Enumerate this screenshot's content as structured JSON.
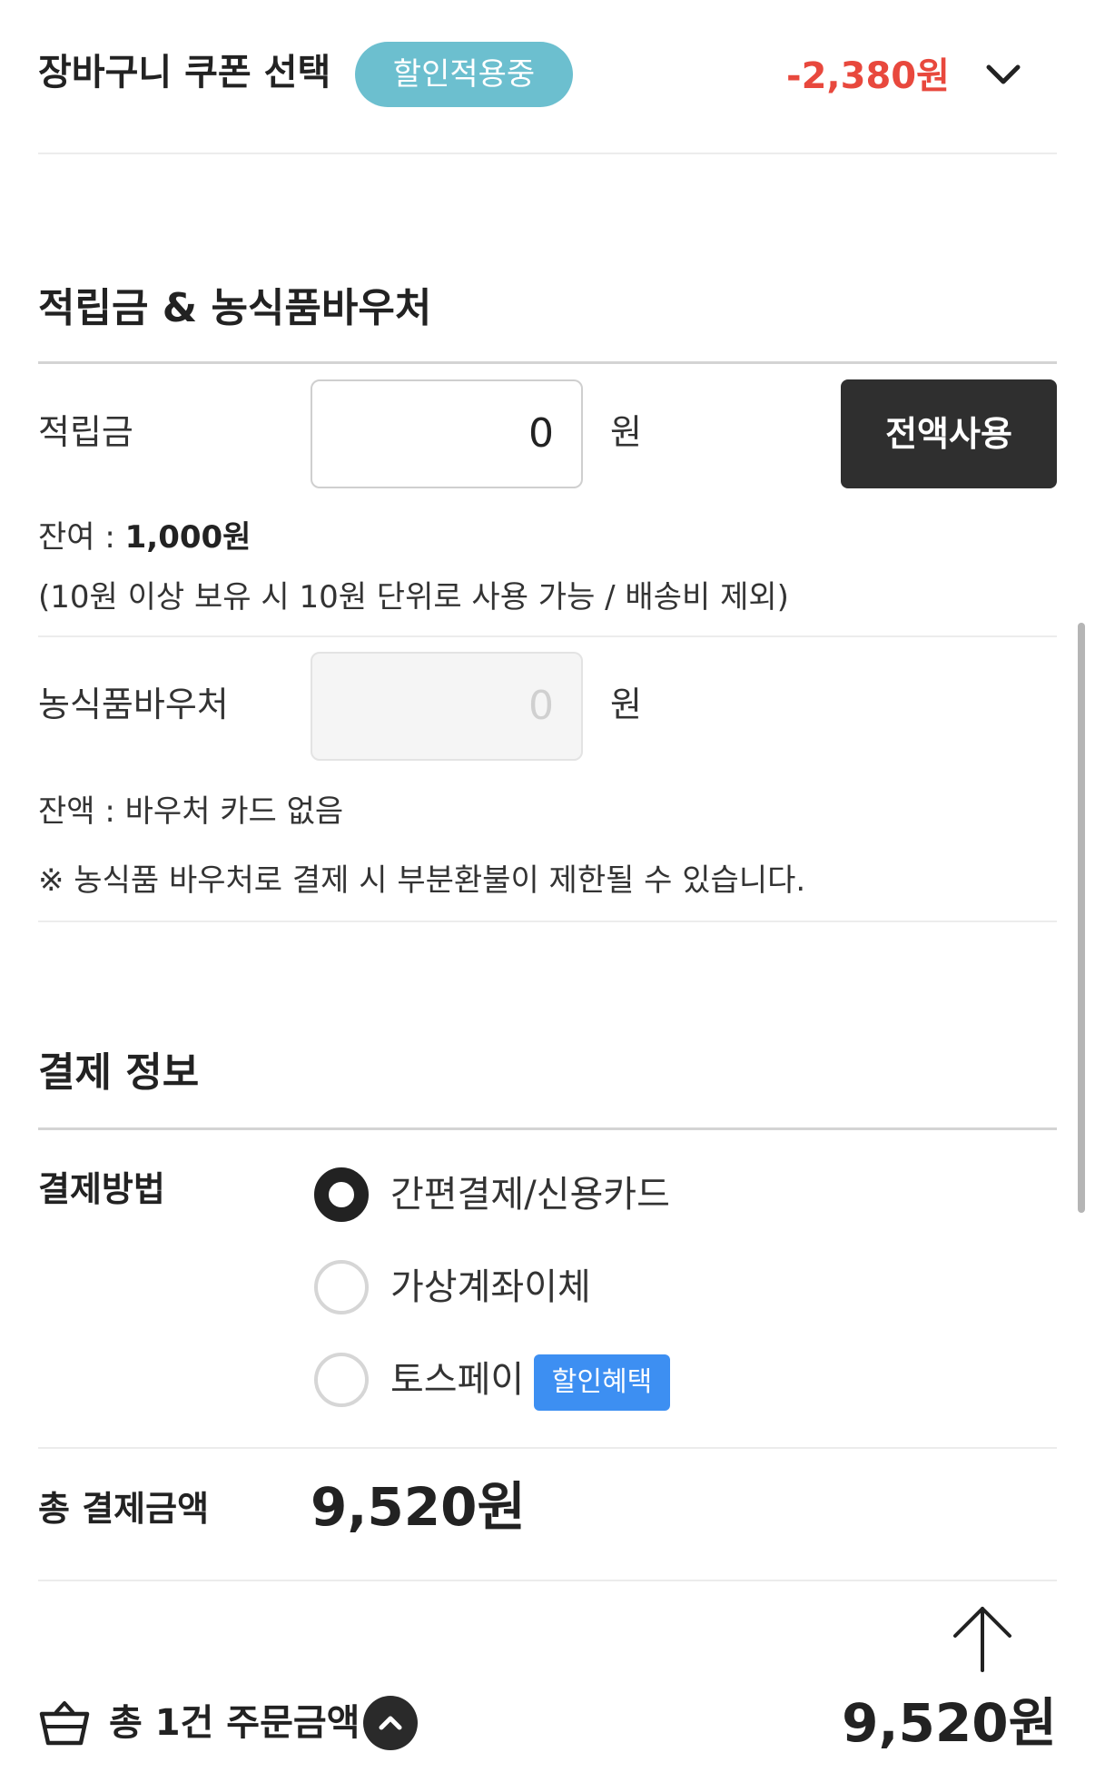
{
  "coupon": {
    "title": "장바구니 쿠폰 선택",
    "badge": "할인적용중",
    "amount": "-2,380원",
    "amount_color": "#e8483d",
    "badge_color": "#6cbfcf",
    "toggle_icon": "chevron-down-icon"
  },
  "points_section": {
    "title": "적립금 & 농식품바우처",
    "points": {
      "label": "적립금",
      "value": "0",
      "unit": "원",
      "use_all_button": "전액사용",
      "balance_prefix": "잔여 : ",
      "balance_value": "1,000원",
      "note": "(10원 이상 보유 시 10원 단위로 사용 가능 / 배송비 제외)"
    },
    "voucher": {
      "label": "농식품바우처",
      "placeholder": "0",
      "unit": "원",
      "balance": "잔액 : 바우처 카드 없음",
      "notice": "※ 농식품 바우처로 결제 시 부분환불이 제한될 수 있습니다."
    }
  },
  "payment_section": {
    "title": "결제 정보",
    "method_label": "결제방법",
    "methods": [
      {
        "label": "간편결제/신용카드",
        "selected": true
      },
      {
        "label": "가상계좌이체",
        "selected": false
      },
      {
        "label": "토스페이",
        "selected": false,
        "badge": "할인혜택"
      }
    ],
    "badge_color": "#3d8ff2",
    "total_label": "총 결제금액",
    "total_amount": "9,520원"
  },
  "footer": {
    "scroll_top_icon": "arrow-up-icon",
    "cart_icon": "basket-icon",
    "order_label": "총 1건 주문금액",
    "expand_icon": "chevron-up-icon",
    "order_total": "9,520원"
  }
}
